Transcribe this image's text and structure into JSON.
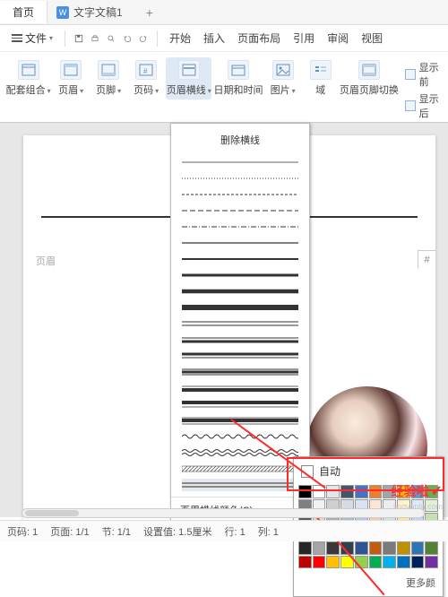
{
  "tabs": {
    "home": "首页",
    "doc": "文字文稿1",
    "add": "+"
  },
  "file_menu": "文件",
  "top_menu": [
    "开始",
    "插入",
    "页面布局",
    "引用",
    "审阅",
    "视图"
  ],
  "ribbon": {
    "matching": "配套组合",
    "header": "页眉",
    "footer": "页脚",
    "page_num": "页码",
    "header_line": "页眉横线",
    "date_time": "日期和时间",
    "picture": "图片",
    "field": "域",
    "switch": "页眉页脚切换",
    "show_prev": "显示前",
    "show_next": "显示后"
  },
  "dropdown": {
    "remove": "删除横线",
    "color": "页眉横线颜色(C)"
  },
  "color_popup": {
    "auto": "自动",
    "more": "更多颜"
  },
  "page": {
    "header_label": "页眉"
  },
  "watermark": {
    "text": "经验啦",
    "sub": "jingyanla.com"
  },
  "status": {
    "page": "页码: 1",
    "pages": "页面: 1/1",
    "section": "节: 1/1",
    "setting": "设置值: 1.5厘米",
    "row": "行: 1",
    "col": "列: 1"
  },
  "chart_data": null,
  "swatch_colors": [
    "#000000",
    "#ffffff",
    "#e7e6e6",
    "#44546a",
    "#4472c4",
    "#ed7d31",
    "#a5a5a5",
    "#ffc000",
    "#5b9bd5",
    "#70ad47",
    "#7f7f7f",
    "#f2f2f2",
    "#d0cece",
    "#d6dce4",
    "#d9e2f3",
    "#fbe5d5",
    "#ededed",
    "#fff2cc",
    "#deebf6",
    "#e2efd9",
    "#595959",
    "#d8d8d8",
    "#aeabab",
    "#adb9ca",
    "#b4c6e7",
    "#f7cbac",
    "#dbdbdb",
    "#fee599",
    "#bdd7ee",
    "#c5e0b3",
    "#3f3f3f",
    "#bfbfbf",
    "#757070",
    "#8496b0",
    "#8eaadb",
    "#f4b183",
    "#c9c9c9",
    "#ffd965",
    "#9cc3e5",
    "#a8d08d",
    "#262626",
    "#a5a5a5",
    "#3a3838",
    "#323f4f",
    "#2f5496",
    "#c55a11",
    "#7b7b7b",
    "#bf9000",
    "#2e75b5",
    "#538135",
    "#c00000",
    "#ff0000",
    "#ffc000",
    "#ffff00",
    "#92d050",
    "#00b050",
    "#00b0f0",
    "#0070c0",
    "#002060",
    "#7030a0"
  ]
}
